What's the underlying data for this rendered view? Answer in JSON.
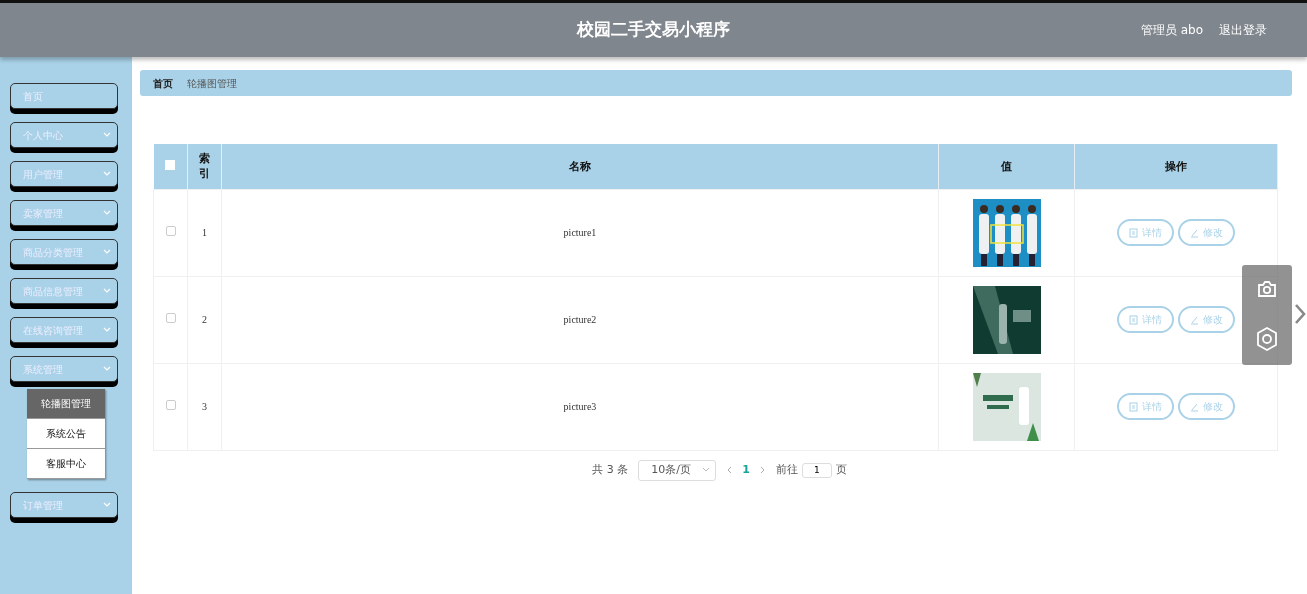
{
  "header": {
    "title": "校园二手交易小程序",
    "user": "管理员 abo",
    "logout": "退出登录"
  },
  "sidebar": {
    "items": [
      {
        "label": "首页",
        "has_arrow": false
      },
      {
        "label": "个人中心",
        "has_arrow": true
      },
      {
        "label": "用户管理",
        "has_arrow": true
      },
      {
        "label": "卖家管理",
        "has_arrow": true
      },
      {
        "label": "商品分类管理",
        "has_arrow": true
      },
      {
        "label": "商品信息管理",
        "has_arrow": true
      },
      {
        "label": "在线咨询管理",
        "has_arrow": true
      },
      {
        "label": "系统管理",
        "has_arrow": true,
        "children": [
          {
            "label": "轮播图管理",
            "selected": true
          },
          {
            "label": "系统公告",
            "selected": false
          },
          {
            "label": "客服中心",
            "selected": false
          }
        ]
      },
      {
        "label": "订单管理",
        "has_arrow": true
      }
    ]
  },
  "breadcrumb": [
    {
      "label": "首页",
      "current": false
    },
    {
      "label": "轮播图管理",
      "current": true
    }
  ],
  "table": {
    "select_all": {
      "checked": false
    },
    "columns": [
      "索引",
      "名称",
      "值",
      "操作"
    ],
    "rows": [
      {
        "checked": false,
        "index": "1",
        "name": "picture1",
        "value": {
          "kind": "picture"
        },
        "actions": [
          {
            "kind": "detail",
            "label": "详情"
          },
          {
            "kind": "edit",
            "label": "修改"
          }
        ]
      },
      {
        "checked": false,
        "index": "2",
        "name": "picture2",
        "value": {
          "kind": "picture"
        },
        "actions": [
          {
            "kind": "detail",
            "label": "详情"
          },
          {
            "kind": "edit",
            "label": "修改"
          }
        ]
      },
      {
        "checked": false,
        "index": "3",
        "name": "picture3",
        "value": {
          "kind": "picture"
        },
        "actions": [
          {
            "kind": "detail",
            "label": "详情"
          },
          {
            "kind": "edit",
            "label": "修改"
          }
        ]
      }
    ]
  },
  "pagination": {
    "total": "共 3 条",
    "page_size": "10条/页",
    "pages": [
      {
        "label": "1",
        "selected": true
      }
    ],
    "goto_label": "前往",
    "goto_value": "1",
    "goto_suffix": "页"
  }
}
